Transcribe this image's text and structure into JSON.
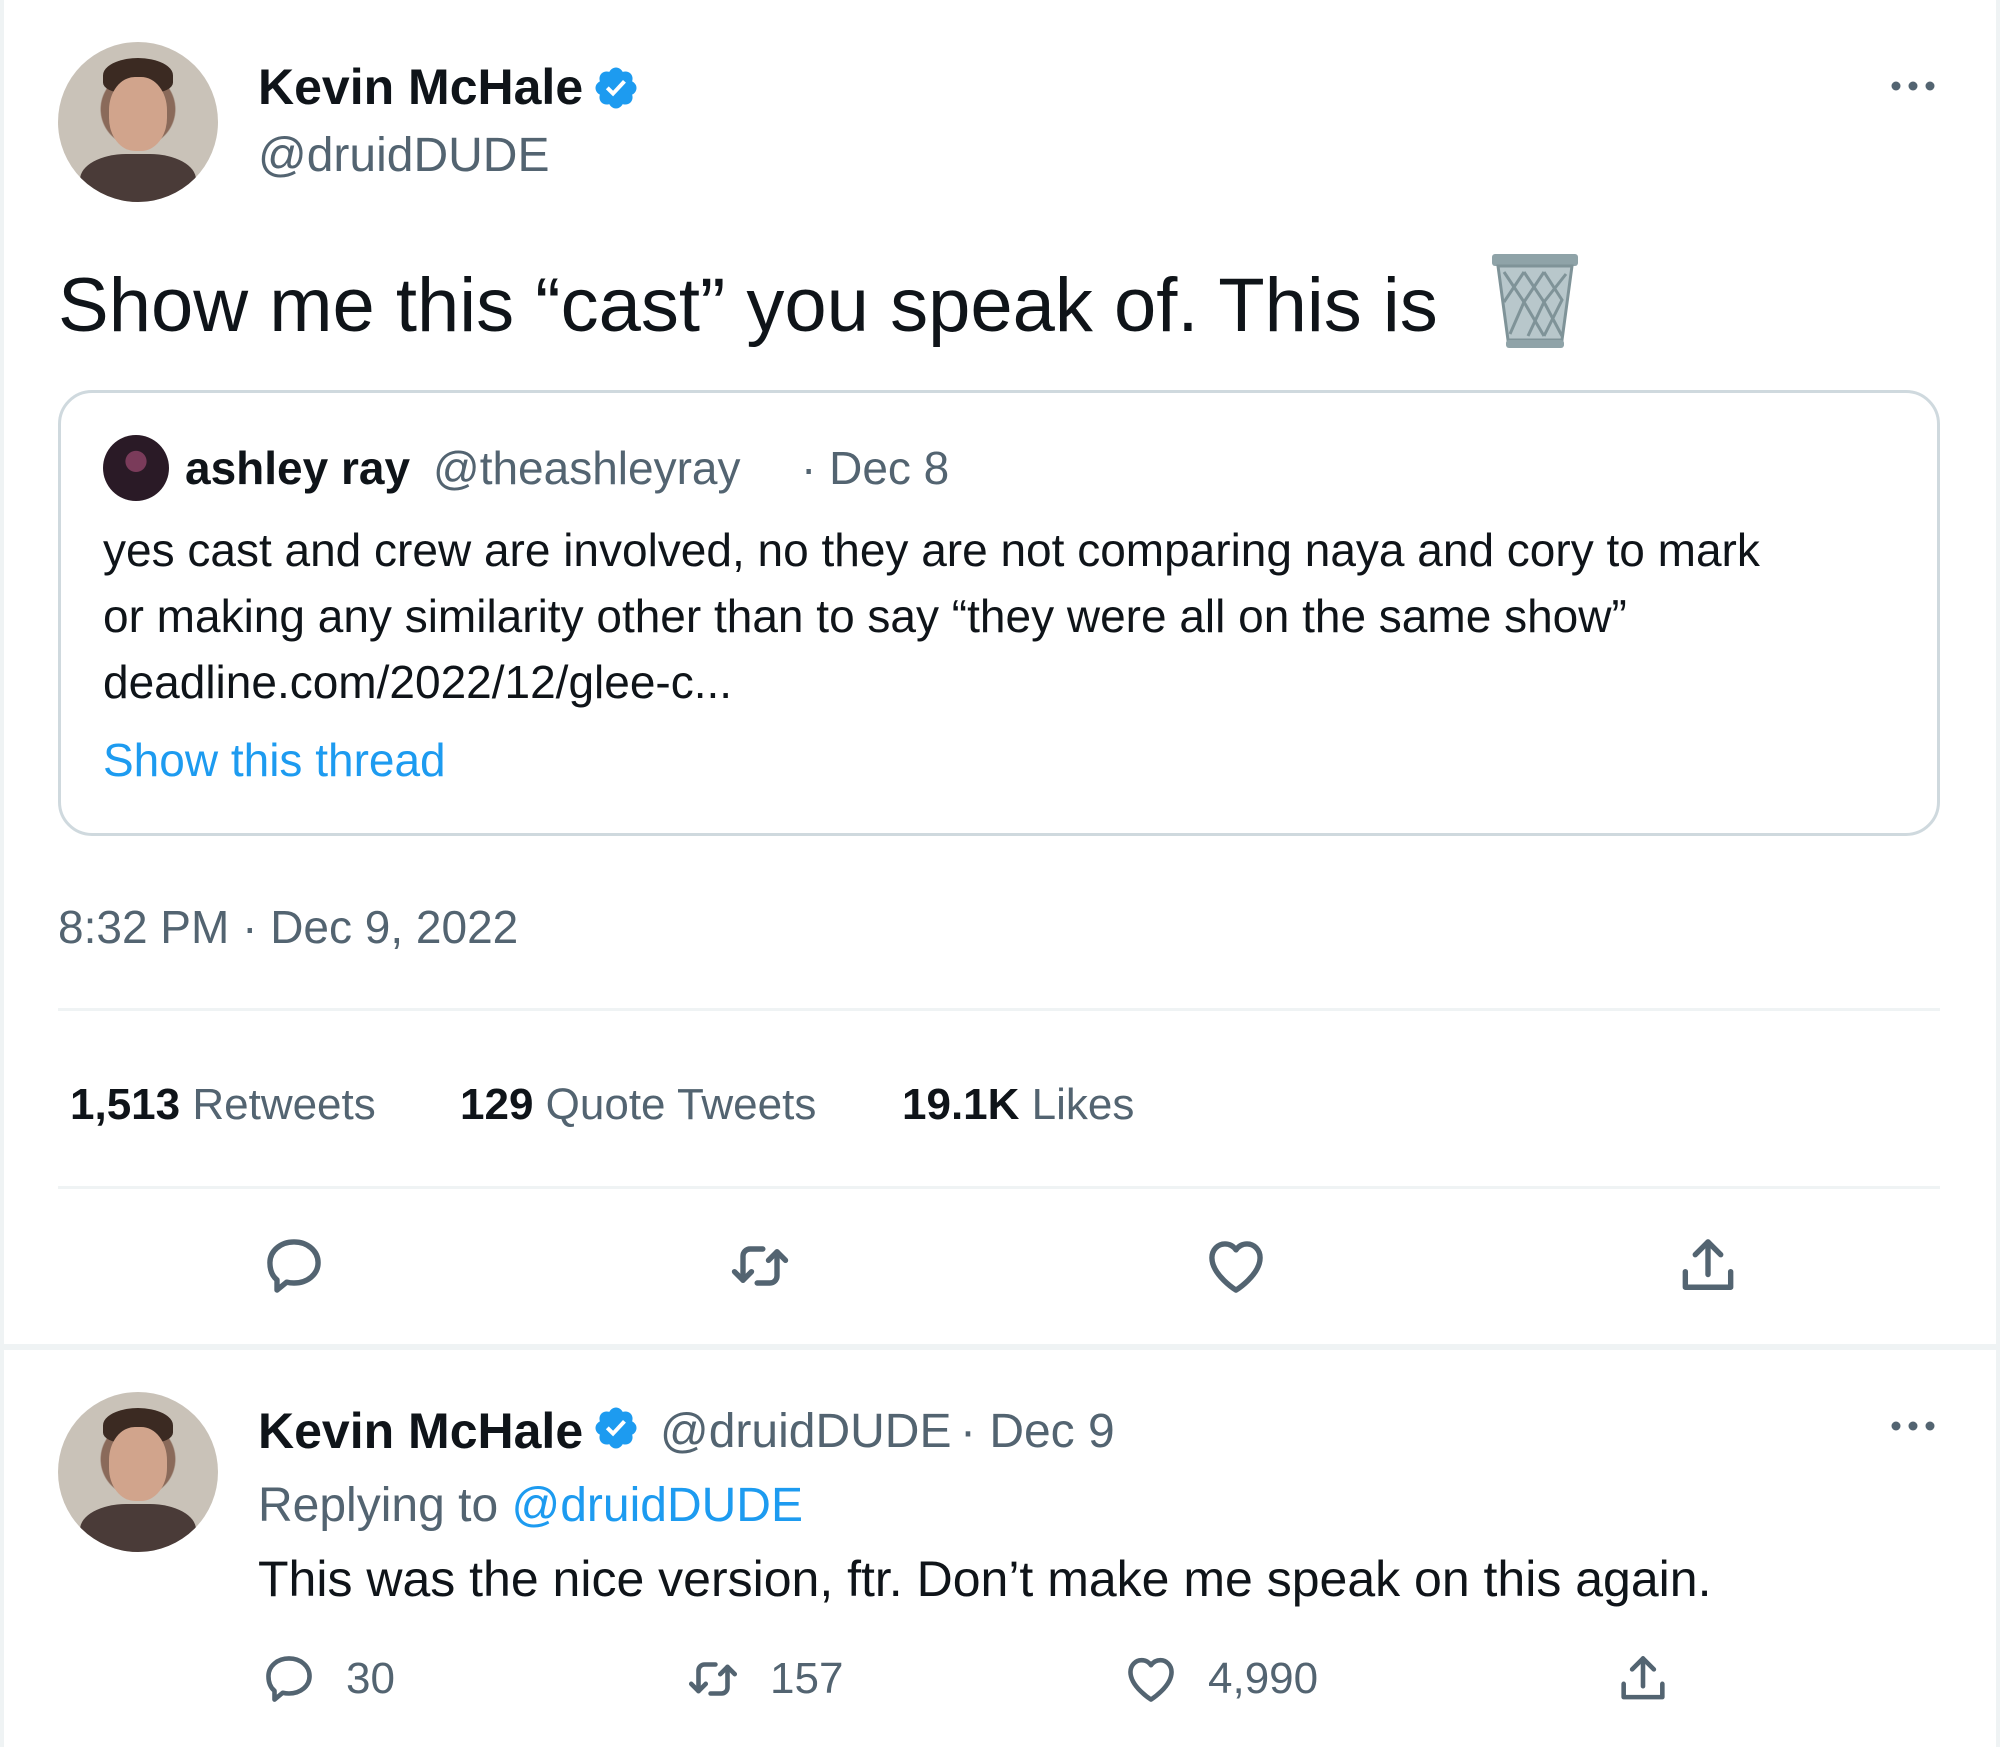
{
  "main_tweet": {
    "author_name": "Kevin McHale",
    "handle": "@druidDUDE",
    "text": "Show me this “cast” you speak of. This is",
    "emoji_icon": "wastebasket-icon",
    "quoted": {
      "author_name": "ashley ray",
      "handle": "@theashleyray",
      "date": "· Dec 8",
      "lines": [
        "yes cast and crew are involved, no they are not comparing naya and cory to mark",
        "or making any similarity other than to say “they were all on the same show”",
        "deadline.com/2022/12/glee-c..."
      ],
      "show_thread": "Show this thread"
    },
    "timestamp": "8:32 PM · Dec 9, 2022",
    "stats": [
      {
        "count": "1,513",
        "label": "Retweets"
      },
      {
        "count": "129",
        "label": "Quote Tweets"
      },
      {
        "count": "19.1K",
        "label": "Likes"
      }
    ],
    "actions": [
      "reply-icon",
      "retweet-icon",
      "like-icon",
      "share-icon"
    ]
  },
  "reply_tweet": {
    "author_name": "Kevin McHale",
    "handle": "@druidDUDE",
    "date": "· Dec 9",
    "replying_prefix": "Replying to",
    "replying_to": "@druidDUDE",
    "text": "This was the nice version, ftr. Don’t make me speak on this again.",
    "counts": {
      "replies": "30",
      "retweets": "157",
      "likes": "4,990"
    }
  },
  "colors": {
    "accent": "#1d9bf0",
    "secondary_text": "#536471",
    "border": "#cfd9de"
  }
}
